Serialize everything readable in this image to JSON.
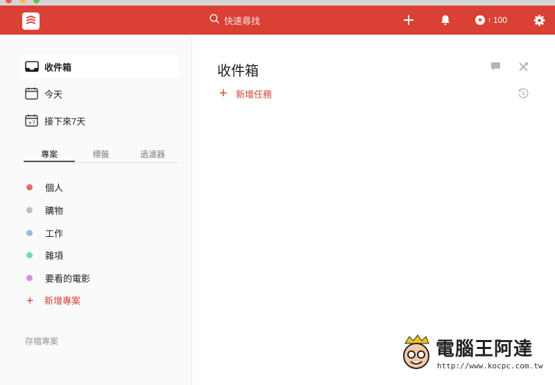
{
  "header": {
    "search_placeholder": "快速尋找",
    "karma_value": "100",
    "icons": [
      "todoist-logo-icon",
      "search-icon",
      "plus-icon",
      "bell-icon",
      "karma-icon",
      "gear-icon"
    ]
  },
  "sidebar": {
    "nav": [
      {
        "label": "收件箱",
        "icon": "inbox-icon",
        "active": true
      },
      {
        "label": "今天",
        "icon": "calendar-icon"
      },
      {
        "label": "接下來7天",
        "icon": "calendar-next7-icon",
        "badge": "+7"
      }
    ],
    "tabs": [
      "專案",
      "標籤",
      "過濾器"
    ],
    "projects": [
      {
        "label": "個人",
        "color": "#f06a58"
      },
      {
        "label": "購物",
        "color": "#bdbdbd"
      },
      {
        "label": "工作",
        "color": "#95bce3"
      },
      {
        "label": "雜項",
        "color": "#6cdcc0"
      },
      {
        "label": "要看的電影",
        "color": "#d891ea"
      }
    ],
    "add_project": "新增專案",
    "archive": "存檔專案"
  },
  "main": {
    "title": "收件箱",
    "add_task": "新增任務"
  },
  "watermark": {
    "title": "電腦王阿達",
    "url": "http://www.kocpc.com.tw"
  },
  "colors": {
    "brand_red": "#db4035",
    "sidebar_bg": "#fafafa"
  }
}
